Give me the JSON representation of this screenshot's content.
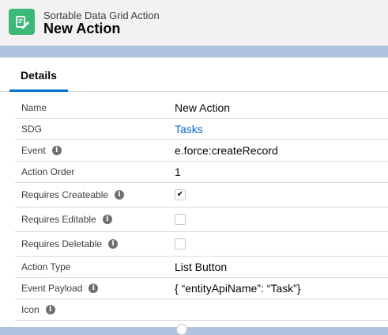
{
  "header": {
    "object_label": "Sortable Data Grid Action",
    "record_title": "New Action",
    "icon": "edit-record-icon",
    "icon_color": "#3cb879"
  },
  "tabs": [
    {
      "label": "Details",
      "active": true
    }
  ],
  "accent_color": "#0070d2",
  "fields": [
    {
      "label": "Name",
      "value": "New Action"
    },
    {
      "label": "SDG",
      "value": "Tasks",
      "link": true
    },
    {
      "label": "Event",
      "value": "e.force:createRecord",
      "help": true
    },
    {
      "label": "Action Order",
      "value": "1"
    },
    {
      "label": "Requires Createable",
      "checked": true,
      "help": true
    },
    {
      "label": "Requires Editable",
      "checked": false,
      "help": true
    },
    {
      "label": "Requires Deletable",
      "checked": false,
      "help": true
    },
    {
      "label": "Action Type",
      "value": "List Button"
    },
    {
      "label": "Event Payload",
      "value": "{ “entityApiName”: “Task”}",
      "help": true
    },
    {
      "label": "Icon",
      "value": "",
      "help": true
    }
  ],
  "help_icon_glyph": "i",
  "checkmark_glyph": "✔"
}
